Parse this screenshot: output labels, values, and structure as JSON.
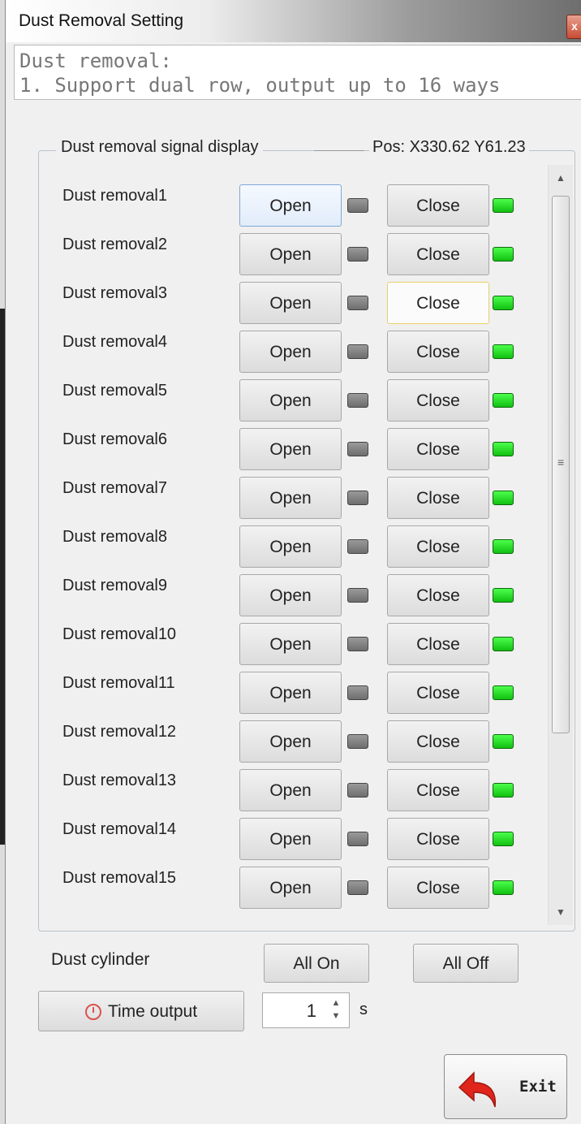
{
  "window": {
    "title": "Dust Removal Setting",
    "close_label": "x"
  },
  "info": {
    "line1": "Dust removal:",
    "line2": "1. Support dual row, output up to 16 ways"
  },
  "signal_group": {
    "label": "Dust removal signal display",
    "pos_text": "Pos: X330.62  Y61.23"
  },
  "rows": [
    {
      "label": "Dust removal1",
      "open": "Open",
      "close": "Close"
    },
    {
      "label": "Dust removal2",
      "open": "Open",
      "close": "Close"
    },
    {
      "label": "Dust removal3",
      "open": "Open",
      "close": "Close"
    },
    {
      "label": "Dust removal4",
      "open": "Open",
      "close": "Close"
    },
    {
      "label": "Dust removal5",
      "open": "Open",
      "close": "Close"
    },
    {
      "label": "Dust removal6",
      "open": "Open",
      "close": "Close"
    },
    {
      "label": "Dust removal7",
      "open": "Open",
      "close": "Close"
    },
    {
      "label": "Dust removal8",
      "open": "Open",
      "close": "Close"
    },
    {
      "label": "Dust removal9",
      "open": "Open",
      "close": "Close"
    },
    {
      "label": "Dust removal10",
      "open": "Open",
      "close": "Close"
    },
    {
      "label": "Dust removal11",
      "open": "Open",
      "close": "Close"
    },
    {
      "label": "Dust removal12",
      "open": "Open",
      "close": "Close"
    },
    {
      "label": "Dust removal13",
      "open": "Open",
      "close": "Close"
    },
    {
      "label": "Dust removal14",
      "open": "Open",
      "close": "Close"
    },
    {
      "label": "Dust removal15",
      "open": "Open",
      "close": "Close"
    }
  ],
  "indicator_colors": {
    "open_led": "#7a7a7a",
    "close_led": "#22dd22"
  },
  "cylinder": {
    "label": "Dust cylinder",
    "all_on": "All On",
    "all_off": "All Off"
  },
  "timer": {
    "button": "Time output",
    "value": "1",
    "unit": "s"
  },
  "exit": {
    "label": "Exit"
  }
}
